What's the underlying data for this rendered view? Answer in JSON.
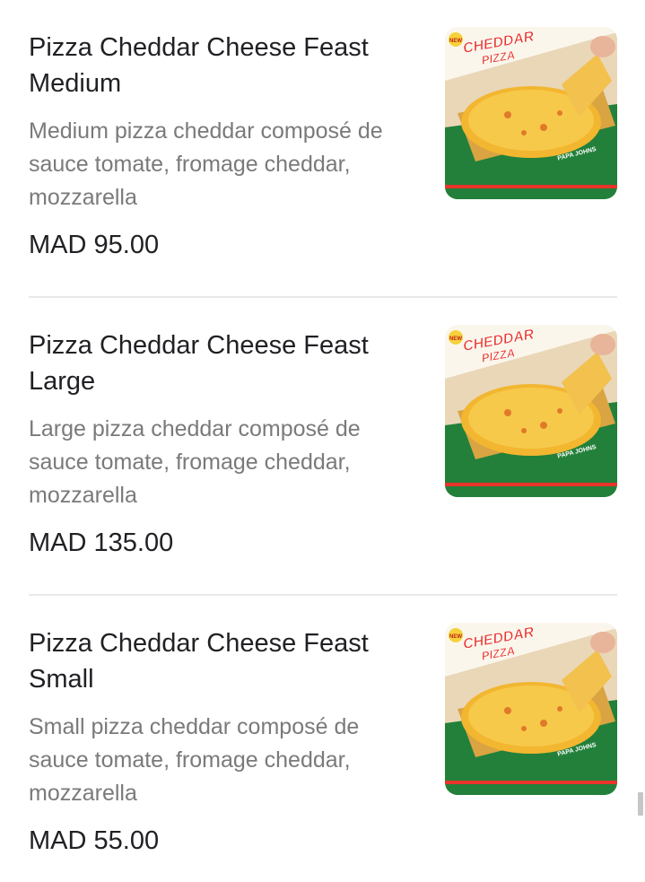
{
  "items": [
    {
      "name": "Pizza Cheddar Cheese Feast Medium",
      "description": "Medium pizza cheddar composé de sauce tomate, fromage cheddar, mozzarella",
      "price": "MAD 95.00",
      "image_badge": "NEW",
      "image_label_1": "CHEDDAR",
      "image_label_2": "PIZZA",
      "image_brand": "PAPA JOHNS"
    },
    {
      "name": "Pizza Cheddar Cheese Feast Large",
      "description": "Large pizza cheddar composé de sauce tomate, fromage cheddar, mozzarella",
      "price": "MAD 135.00",
      "image_badge": "NEW",
      "image_label_1": "CHEDDAR",
      "image_label_2": "PIZZA",
      "image_brand": "PAPA JOHNS"
    },
    {
      "name": "Pizza Cheddar Cheese Feast Small",
      "description": "Small pizza cheddar composé de sauce tomate, fromage cheddar, mozzarella",
      "price": "MAD 55.00",
      "image_badge": "NEW",
      "image_label_1": "CHEDDAR",
      "image_label_2": "PIZZA",
      "image_brand": "PAPA JOHNS"
    }
  ],
  "colors": {
    "title_text": "#202124",
    "description_text": "#7a7a7a",
    "divider": "#e9e9e9",
    "box_green": "#1f7a35",
    "label_red": "#e8342a",
    "cheese": "#f2b630"
  }
}
